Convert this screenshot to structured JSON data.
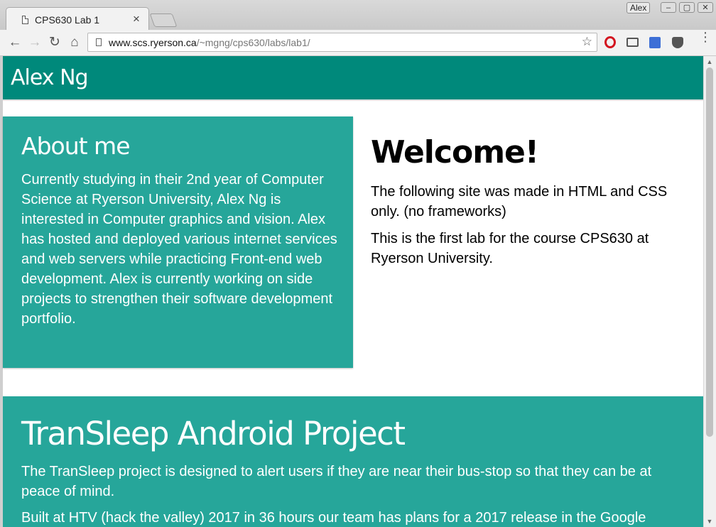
{
  "browser": {
    "tab_title": "CPS630 Lab 1",
    "tab_close": "×",
    "user_badge": "Alex",
    "url_host": "www.scs.ryerson.ca",
    "url_path": "/~mgng/cps630/labs/lab1/",
    "icons": [
      "page-icon",
      "back-icon",
      "forward-icon",
      "reload-icon",
      "home-icon",
      "star-icon",
      "opera-icon",
      "cast-icon",
      "extension-icon",
      "pocket-icon",
      "menu-icon"
    ]
  },
  "page": {
    "site_name": "Alex Ng",
    "about": {
      "heading": "About me",
      "text": "Currently studying in their 2nd year of Computer Science at Ryerson University, Alex Ng is interested in Computer graphics and vision. Alex has hosted and deployed various internet services and web servers while practicing Front-end web development. Alex is currently working on side projects to strengthen their software development portfolio."
    },
    "welcome": {
      "heading": "Welcome!",
      "paragraph1": "The following site was made in HTML and CSS only. (no frameworks)",
      "paragraph2": "This is the first lab for the course CPS630 at Ryerson University."
    },
    "project": {
      "heading": "TranSleep Android Project",
      "paragraph1": "The TranSleep project is designed to alert users if they are near their bus-stop so that they can be at peace of mind.",
      "paragraph2": "Built at HTV (hack the valley) 2017 in 36 hours our team has plans for a 2017 release in the Google"
    }
  },
  "colors": {
    "header": "#00897b",
    "card": "#26a69a"
  }
}
